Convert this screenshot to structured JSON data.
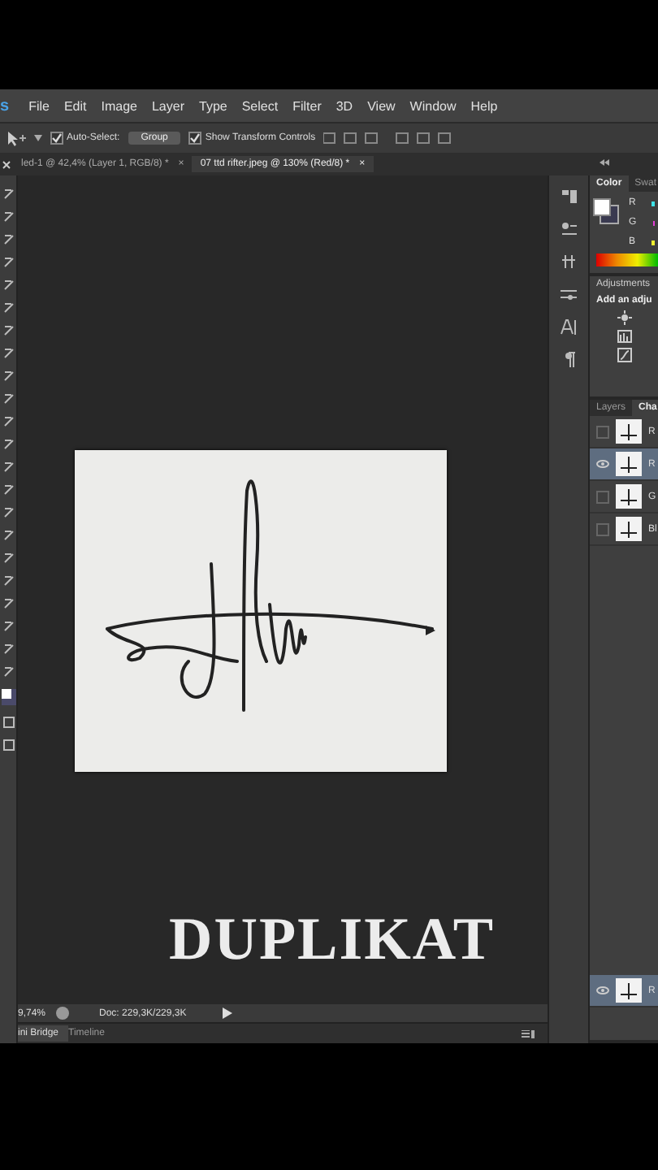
{
  "menu_bar": {
    "logo": "s",
    "items": [
      "File",
      "Edit",
      "Image",
      "Layer",
      "Type",
      "Select",
      "Filter",
      "3D",
      "View",
      "Window",
      "Help"
    ]
  },
  "options_bar": {
    "checkboxes": [
      {
        "label": "Auto-Select:",
        "checked": true
      },
      {
        "label": "Show Transform Controls",
        "checked": true
      }
    ],
    "dropdown": "Group"
  },
  "document_tabs": [
    {
      "label": "led-1 @ 42,4% (Layer 1, RGB/8) *",
      "close": "×",
      "selected": false
    },
    {
      "label": "07 ttd rifter.jpeg @ 130% (Red/8) *",
      "close": "×",
      "selected": true
    }
  ],
  "caption": "DUPLIKAT",
  "status_bar": {
    "zoom": "9,74%",
    "doc": "Doc: 229,3K/229,3K"
  },
  "bottom_tabs": [
    {
      "label": "ini Bridge",
      "selected": true
    },
    {
      "label": "Timeline",
      "selected": false
    }
  ],
  "color_panel": {
    "tabs": [
      {
        "label": "Color",
        "selected": true
      },
      {
        "label": "Swat",
        "selected": false
      }
    ],
    "channels": [
      "R",
      "G",
      "B"
    ]
  },
  "adjustments_panel": {
    "title": "Adjustments",
    "hint": "Add an adju"
  },
  "channels_panel": {
    "tabs": [
      {
        "label": "Layers",
        "selected": false
      },
      {
        "label": "Cha",
        "selected": true
      }
    ],
    "rows": [
      {
        "label": "R",
        "visible": false,
        "selected": false
      },
      {
        "label": "R",
        "visible": true,
        "selected": true
      },
      {
        "label": "G",
        "visible": false,
        "selected": false
      },
      {
        "label": "Bl",
        "visible": false,
        "selected": false
      }
    ],
    "bottom_row": {
      "label": "R",
      "visible": true,
      "selected": true
    }
  }
}
